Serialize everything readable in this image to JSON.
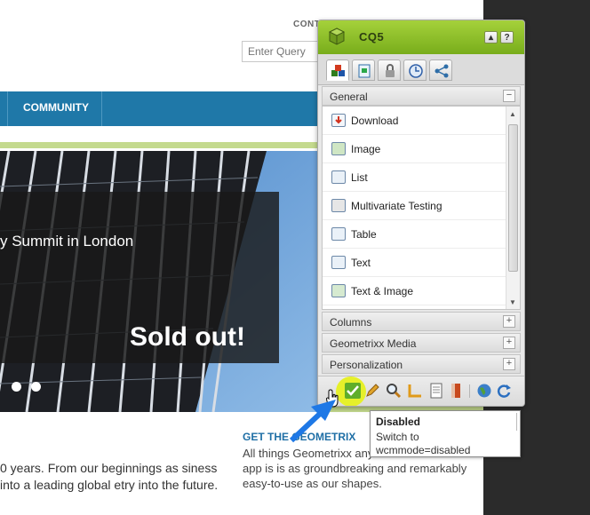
{
  "page": {
    "contact_label": "CONT",
    "search": {
      "placeholder": "Enter Query"
    },
    "nav": {
      "items": [
        {
          "label": "COMMUNITY"
        }
      ]
    },
    "hero": {
      "caption": "y Summit in London",
      "badge": "Sold out!"
    },
    "body_text": "0 years. From our beginnings as siness into a leading global etry into the future.",
    "promo": {
      "title": "GET THE GEOMETRIX",
      "text": "All things Geometrixx anywhere. Our mobile app is is as groundbreaking and remarkably easy-to-use as our shapes."
    }
  },
  "sidekick": {
    "title": "CQ5",
    "header_buttons": [
      {
        "icon": "collapse-up-icon"
      },
      {
        "icon": "help-icon",
        "label": "?"
      }
    ],
    "tabs": [
      {
        "icon": "components-icon",
        "active": true
      },
      {
        "icon": "page-icon"
      },
      {
        "icon": "lock-icon"
      },
      {
        "icon": "clock-icon"
      },
      {
        "icon": "workflow-icon"
      }
    ],
    "groups": {
      "general": {
        "label": "General",
        "toggle": "−"
      },
      "columns": {
        "label": "Columns",
        "toggle": "+"
      },
      "media": {
        "label": "Geometrixx Media",
        "toggle": "+"
      },
      "personalization": {
        "label": "Personalization",
        "toggle": "+"
      }
    },
    "components": [
      {
        "label": "Download",
        "icon": "download-icon"
      },
      {
        "label": "Image",
        "icon": "image-icon"
      },
      {
        "label": "List",
        "icon": "list-icon"
      },
      {
        "label": "Multivariate Testing",
        "icon": "multivariate-icon"
      },
      {
        "label": "Table",
        "icon": "table-icon"
      },
      {
        "label": "Text",
        "icon": "text-icon"
      },
      {
        "label": "Text & Image",
        "icon": "text-image-icon"
      }
    ],
    "toolbar": [
      "edit-mode-check-icon",
      "design-mode-pencil-icon",
      "preview-magnifier-icon",
      "scaffolding-icon",
      "page-properties-icon",
      "bookmark-icon",
      "globe-icon",
      "refresh-icon"
    ]
  },
  "tooltip": {
    "title": "Disabled",
    "line1": "Switch to",
    "line2": "wcmmode=disabled"
  },
  "colors": {
    "nav": "#1f78a8",
    "sidekick_header": "#8fc12a",
    "accent_green": "#c4da8e",
    "link_blue": "#1f6fa6",
    "highlight_yellow": "#e6f02a",
    "pointer_blue": "#1e78e6"
  }
}
